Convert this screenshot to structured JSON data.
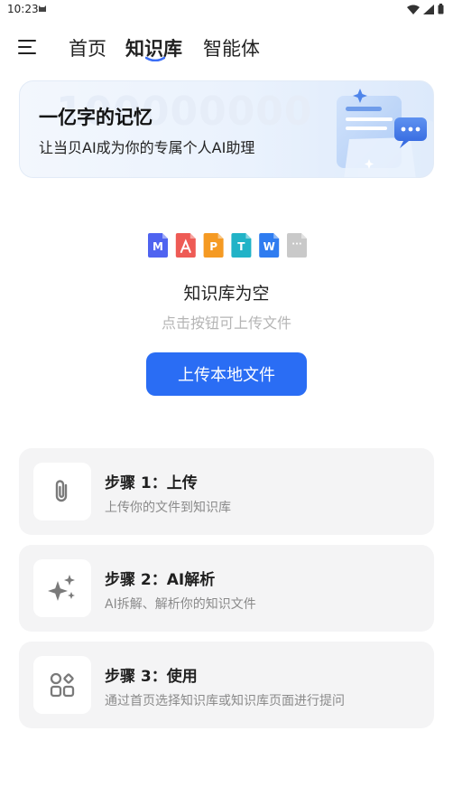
{
  "status_bar": {
    "time": "10:23",
    "icons": [
      "cat-icon",
      "wifi-icon",
      "signal-icon",
      "battery-icon"
    ]
  },
  "nav": {
    "menu_icon": "menu-icon",
    "tabs": [
      {
        "label": "首页",
        "active": false
      },
      {
        "label": "知识库",
        "active": true
      },
      {
        "label": "智能体",
        "active": false
      }
    ]
  },
  "banner": {
    "bg_number": "100000000",
    "title": "一亿字的记忆",
    "subtitle": "让当贝AI成为你的专属个人AI助理"
  },
  "empty_state": {
    "file_types": [
      {
        "icon": "markdown-file-icon",
        "letter": "M",
        "color": "#4f63f0"
      },
      {
        "icon": "pdf-file-icon",
        "letter": "",
        "color": "#ee5b55"
      },
      {
        "icon": "ppt-file-icon",
        "letter": "P",
        "color": "#f59a23"
      },
      {
        "icon": "txt-file-icon",
        "letter": "T",
        "color": "#21b3c7"
      },
      {
        "icon": "word-file-icon",
        "letter": "W",
        "color": "#2f7cf0"
      },
      {
        "icon": "more-file-icon",
        "letter": "···",
        "color": "#c9c9c9"
      }
    ],
    "title": "知识库为空",
    "subtitle": "点击按钮可上传文件",
    "upload_button": "上传本地文件"
  },
  "steps": [
    {
      "icon": "paperclip-icon",
      "title": "步骤 1：上传",
      "desc": "上传你的文件到知识库"
    },
    {
      "icon": "sparkle-icon",
      "title": "步骤 2：AI解析",
      "desc": "AI拆解、解析你的知识文件"
    },
    {
      "icon": "apps-grid-icon",
      "title": "步骤 3：使用",
      "desc": "通过首页选择知识库或知识库页面进行提问"
    }
  ],
  "colors": {
    "accent": "#2a6df4",
    "step_bg": "#f4f4f5",
    "muted_text": "#8a8a8a"
  }
}
